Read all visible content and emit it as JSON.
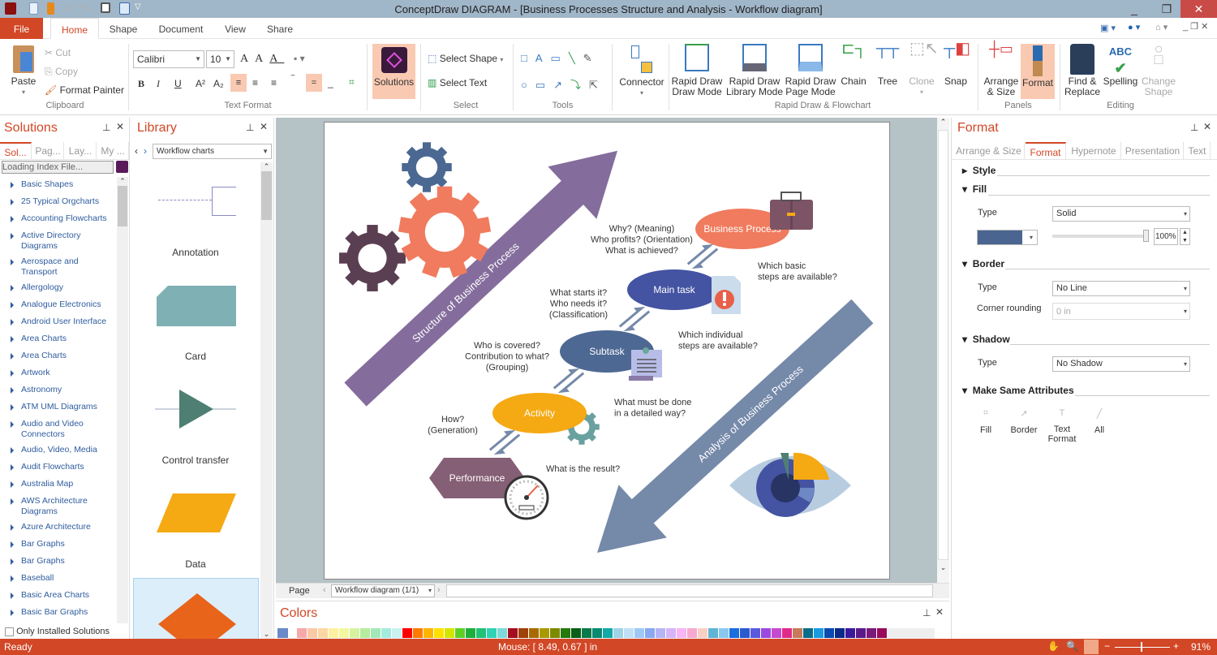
{
  "window": {
    "title": "ConceptDraw DIAGRAM - [Business Processes Structure and Analysis - Workflow diagram]",
    "minimize": "_",
    "maximize": "❐",
    "close": "✕"
  },
  "tabs": {
    "file": "File",
    "home": "Home",
    "shape": "Shape",
    "document": "Document",
    "view": "View",
    "share": "Share"
  },
  "ribbon": {
    "clipboard": {
      "label": "Clipboard",
      "paste": "Paste",
      "cut": "Cut",
      "copy": "Copy",
      "format_painter": "Format Painter"
    },
    "text_format": {
      "label": "Text Format",
      "font": "Calibri",
      "size": "10"
    },
    "solutions": {
      "label": "Solutions"
    },
    "select": {
      "label": "Select",
      "select_shape": "Select Shape",
      "select_text": "Select Text"
    },
    "tools": {
      "label": "Tools"
    },
    "connector": "Connector",
    "rapid": {
      "label": "Rapid Draw & Flowchart",
      "mode1": "Rapid Draw",
      "mode1b": "Draw Mode",
      "mode2": "Rapid Draw",
      "mode2b": "Library Mode",
      "mode3": "Rapid Draw",
      "mode3b": "Page Mode",
      "chain": "Chain",
      "tree": "Tree",
      "clone": "Clone",
      "snap": "Snap"
    },
    "panels": {
      "label": "Panels",
      "arrange": "Arrange",
      "arrange_b": "& Size",
      "format": "Format"
    },
    "editing": {
      "label": "Editing",
      "find": "Find &",
      "find_b": "Replace",
      "spelling": "Spelling",
      "change": "Change",
      "change_b": "Shape"
    }
  },
  "solutions_panel": {
    "title": "Solutions",
    "tabs": [
      "Sol...",
      "Pag...",
      "Lay...",
      "My ..."
    ],
    "search_value": "Loading Index File...",
    "items": [
      "Basic Shapes",
      "25 Typical Orgcharts",
      "Accounting Flowcharts",
      "Active Directory Diagrams",
      "Aerospace and Transport",
      "Allergology",
      "Analogue Electronics",
      "Android User Interface",
      "Area Charts",
      "Area Charts",
      "Artwork",
      "Astronomy",
      "ATM UML Diagrams",
      "Audio and Video Connectors",
      "Audio, Video, Media",
      "Audit Flowcharts",
      "Australia Map",
      "AWS Architecture Diagrams",
      "Azure Architecture",
      "Bar Graphs",
      "Bar Graphs",
      "Baseball",
      "Basic Area Charts",
      "Basic Bar Graphs"
    ],
    "only_installed": "Only Installed Solutions"
  },
  "library_panel": {
    "title": "Library",
    "selected": "Workflow charts",
    "items": [
      "Annotation",
      "Card",
      "Control transfer",
      "Data"
    ]
  },
  "diagram": {
    "arrow_up": "Structure of Business Process",
    "arrow_down": "Analysis of Business Process",
    "nodes": {
      "business_process": "Business Process",
      "main_task": "Main task",
      "subtask": "Subtask",
      "activity": "Activity",
      "performance": "Performance"
    },
    "q_bp": [
      "Why? (Meaning)",
      "Who profits? (Orientation)",
      "What is achieved?"
    ],
    "q_basic": [
      "Which basic",
      "steps are available?"
    ],
    "q_main": [
      "What starts it?",
      "Who needs it?",
      "(Classification)"
    ],
    "q_indiv": [
      "Which individual",
      "steps are available?"
    ],
    "q_sub": [
      "Who is covered?",
      "Contribution to what?",
      "(Grouping)"
    ],
    "q_act": [
      "What must be done",
      "in a detailed way?"
    ],
    "q_how": [
      "How?",
      "(Generation)"
    ],
    "q_result": "What is the result?",
    "colors": {
      "bp": "#f07b5e",
      "main": "#4453a2",
      "sub": "#4d6893",
      "act": "#f5a912",
      "perf": "#855f75",
      "arrow_up": "#846d9c",
      "arrow_down": "#7589a9"
    }
  },
  "page_nav": {
    "label": "Page",
    "page": "Workflow diagram (1/1)"
  },
  "colors_panel": {
    "title": "Colors",
    "swatches": [
      "#f7a8a8",
      "#fbc9a4",
      "#fcd7a4",
      "#fdf0a0",
      "#f2f7a0",
      "#d6f2a0",
      "#b5ec9e",
      "#a3e8b8",
      "#a3ecdd",
      "#c9f2f0",
      "#ff0000",
      "#ff7a00",
      "#ffb400",
      "#ffe000",
      "#d4e600",
      "#5fcf28",
      "#1fae3c",
      "#21c178",
      "#2fd4b4",
      "#7fd9d9",
      "#a50e1e",
      "#a0400a",
      "#a86a00",
      "#a89a00",
      "#7d8a00",
      "#247a0a",
      "#0a5f17",
      "#0a7a4a",
      "#0a8a70",
      "#14a8a8",
      "#9fd4e8",
      "#bfe0f7",
      "#a0c8f7",
      "#8aa8f0",
      "#b4b4f7",
      "#d6b4f7",
      "#f7b4f7",
      "#f7a8d0",
      "#f7d0c4",
      "#60b4d4",
      "#8ac8f0",
      "#1a6ee0",
      "#2a5ad0",
      "#5a5ae0",
      "#9a4ae0",
      "#c44ad0",
      "#e02a8a",
      "#c87a5a",
      "#0a6e8a",
      "#1a9ae0",
      "#0a4ab0",
      "#0a2a8a",
      "#3a1a9a",
      "#5a1a8a",
      "#7a1a7a",
      "#9a0a5a"
    ]
  },
  "format_panel": {
    "title": "Format",
    "tabs": [
      "Arrange & Size",
      "Format",
      "Hypernote",
      "Presentation",
      "Text"
    ],
    "style": "Style",
    "fill": "Fill",
    "fill_type_label": "Type",
    "fill_type": "Solid",
    "fill_color": "#4a6590",
    "opacity": "100%",
    "opacity_value": 1.0,
    "border": "Border",
    "border_type_label": "Type",
    "border_type": "No Line",
    "corner_label": "Corner rounding",
    "corner": "0 in",
    "shadow": "Shadow",
    "shadow_type_label": "Type",
    "shadow_type": "No Shadow",
    "make_same": "Make Same Attributes",
    "ms_fill": "Fill",
    "ms_border": "Border",
    "ms_text": "Text",
    "ms_text_b": "Format",
    "ms_all": "All"
  },
  "status": {
    "ready": "Ready",
    "mouse": "Mouse: [ 8.49, 0.67 ] in",
    "zoom": "91%",
    "zoom_value": 0.91
  }
}
